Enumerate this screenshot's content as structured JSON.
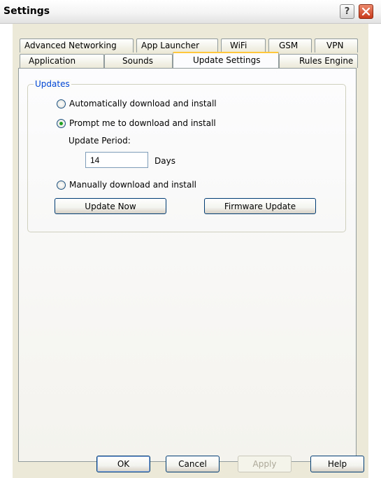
{
  "window": {
    "title": "Settings",
    "help_button": "?",
    "close_button": "close"
  },
  "tabs": {
    "row_back": [
      "Advanced Networking",
      "App Launcher",
      "WiFi",
      "GSM",
      "VPN"
    ],
    "row_front": [
      "Application",
      "Sounds",
      "Update Settings",
      "Rules Engine"
    ],
    "active": "Update Settings"
  },
  "updates": {
    "group_label": "Updates",
    "options": [
      {
        "label": "Automatically download and install",
        "checked": false
      },
      {
        "label": "Prompt me to download and install",
        "checked": true
      },
      {
        "label": "Manually download and install",
        "checked": false
      }
    ],
    "period_label": "Update Period:",
    "period_value": "14",
    "period_unit": "Days",
    "update_now_label": "Update Now",
    "firmware_update_label": "Firmware Update"
  },
  "footer": {
    "ok_label": "OK",
    "cancel_label": "Cancel",
    "apply_label": "Apply",
    "help_label": "Help"
  }
}
